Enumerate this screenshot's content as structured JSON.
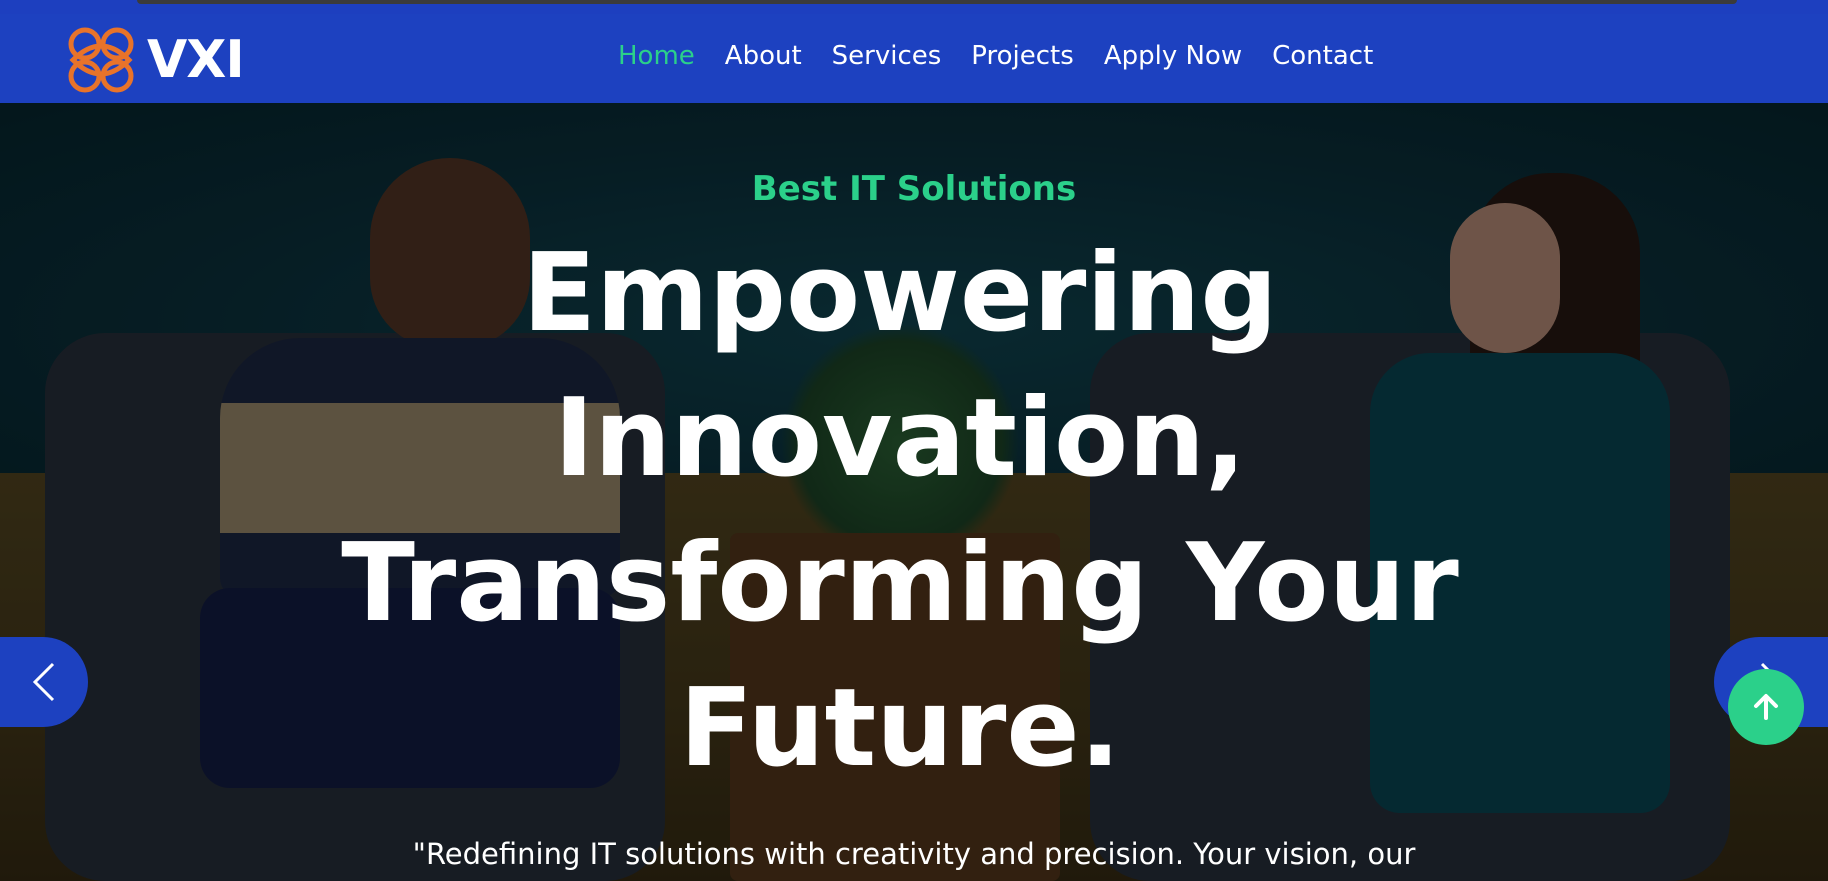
{
  "brand": {
    "name": "VXI",
    "logo_color": "#e8732a"
  },
  "nav": {
    "items": [
      {
        "label": "Home",
        "active": true
      },
      {
        "label": "About",
        "active": false
      },
      {
        "label": "Services",
        "active": false
      },
      {
        "label": "Projects",
        "active": false
      },
      {
        "label": "Apply Now",
        "active": false
      },
      {
        "label": "Contact",
        "active": false
      }
    ],
    "background": "#1d41c0",
    "active_color": "#2bd08a"
  },
  "hero": {
    "subtitle": "Best IT Solutions",
    "headline": "Empowering Innovation, Transforming Your Future.",
    "tagline": "\"Redefining IT solutions with creativity and precision. Your vision, our",
    "prev_icon": "chevron-left-icon",
    "next_icon": "chevron-right-icon"
  },
  "back_to_top": {
    "icon": "arrow-up-icon",
    "color": "#2bd08a"
  }
}
